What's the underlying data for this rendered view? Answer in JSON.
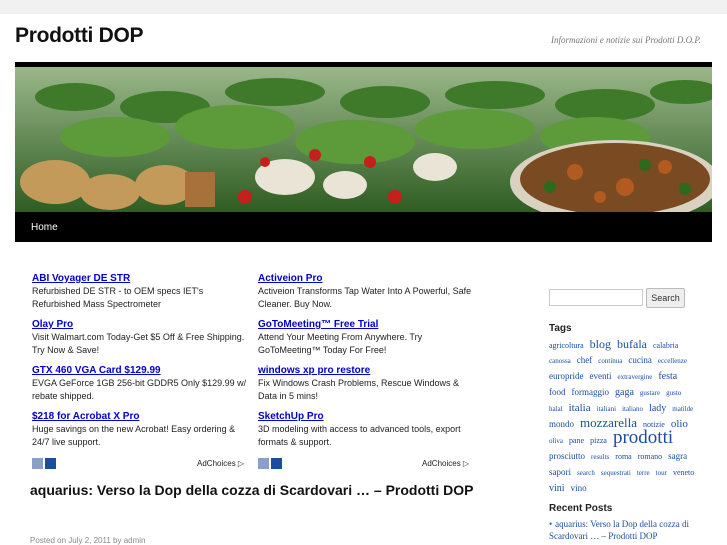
{
  "site": {
    "title": "Prodotti DOP",
    "description": "Informazioni e notizie sui Prodotti D.O.P."
  },
  "nav": {
    "home": "Home"
  },
  "ads": {
    "left": [
      {
        "title": "ABI Voyager DE STR",
        "text": "Refurbished DE STR - to OEM specs IET's Refurbished Mass Spectrometer"
      },
      {
        "title": "Olay Pro",
        "text": "Visit Walmart.com Today-Get $5 Off & Free Shipping. Try Now & Save!"
      },
      {
        "title": "GTX 460 VGA Card $129.99",
        "text": "EVGA GeForce 1GB 256-bit GDDR5 Only $129.99 w/ rebate shipped."
      },
      {
        "title": "$218 for Acrobat X Pro",
        "text": "Huge savings on the new Acrobat! Easy ordering & 24/7 live support."
      }
    ],
    "right": [
      {
        "title": "Activeion Pro",
        "text": "Activeion Transforms Tap Water Into A Powerful, Safe Cleaner. Buy Now."
      },
      {
        "title": "GoToMeeting™ Free Trial",
        "text": "Attend Your Meeting From Anywhere. Try GoToMeeting™ Today For Free!"
      },
      {
        "title": "windows xp pro restore",
        "text": "Fix Windows Crash Problems, Rescue Windows & Data in 5 mins!"
      },
      {
        "title": "SketchUp Pro",
        "text": "3D modeling with access to advanced tools, export formats & support."
      }
    ],
    "adchoices": "AdChoices ▷"
  },
  "post": {
    "title": "aquarius: Verso la Dop della cozza di Scardovari … – Prodotti DOP",
    "meta": "Posted on July 2, 2011 by admin"
  },
  "sidebar": {
    "search_button": "Search",
    "tags_title": "Tags",
    "tags": [
      {
        "label": "agricoltura",
        "size": 8
      },
      {
        "label": "blog",
        "size": 12
      },
      {
        "label": "bufala",
        "size": 12
      },
      {
        "label": "calabria",
        "size": 8
      },
      {
        "label": "canossa",
        "size": 7
      },
      {
        "label": "chef",
        "size": 9
      },
      {
        "label": "continua",
        "size": 7
      },
      {
        "label": "cucina",
        "size": 9
      },
      {
        "label": "eccellenze",
        "size": 7
      },
      {
        "label": "europride",
        "size": 9
      },
      {
        "label": "eventi",
        "size": 9
      },
      {
        "label": "extravergine",
        "size": 7
      },
      {
        "label": "festa",
        "size": 10
      },
      {
        "label": "food",
        "size": 9
      },
      {
        "label": "formaggio",
        "size": 9
      },
      {
        "label": "gaga",
        "size": 10
      },
      {
        "label": "gustare",
        "size": 7
      },
      {
        "label": "gusto",
        "size": 7
      },
      {
        "label": "halal",
        "size": 7
      },
      {
        "label": "italia",
        "size": 11
      },
      {
        "label": "italiani",
        "size": 7
      },
      {
        "label": "italiano",
        "size": 7
      },
      {
        "label": "lady",
        "size": 10
      },
      {
        "label": "matilde",
        "size": 7
      },
      {
        "label": "mondo",
        "size": 9
      },
      {
        "label": "mozzarella",
        "size": 13
      },
      {
        "label": "notizie",
        "size": 8
      },
      {
        "label": "olio",
        "size": 11
      },
      {
        "label": "oliva",
        "size": 7
      },
      {
        "label": "pane",
        "size": 8
      },
      {
        "label": "pizza",
        "size": 8
      },
      {
        "label": "prodotti",
        "size": 19
      },
      {
        "label": "prosciutto",
        "size": 9
      },
      {
        "label": "results",
        "size": 7
      },
      {
        "label": "roma",
        "size": 8
      },
      {
        "label": "romano",
        "size": 8
      },
      {
        "label": "sagra",
        "size": 9
      },
      {
        "label": "sapori",
        "size": 9
      },
      {
        "label": "search",
        "size": 7
      },
      {
        "label": "sequestrati",
        "size": 7
      },
      {
        "label": "terre",
        "size": 7
      },
      {
        "label": "tour",
        "size": 7
      },
      {
        "label": "veneto",
        "size": 8
      },
      {
        "label": "vini",
        "size": 10
      },
      {
        "label": "vino",
        "size": 9
      }
    ],
    "recent_title": "Recent Posts",
    "recent": [
      "aquarius: Verso la Dop della cozza di Scardovari … – Prodotti DOP"
    ]
  }
}
